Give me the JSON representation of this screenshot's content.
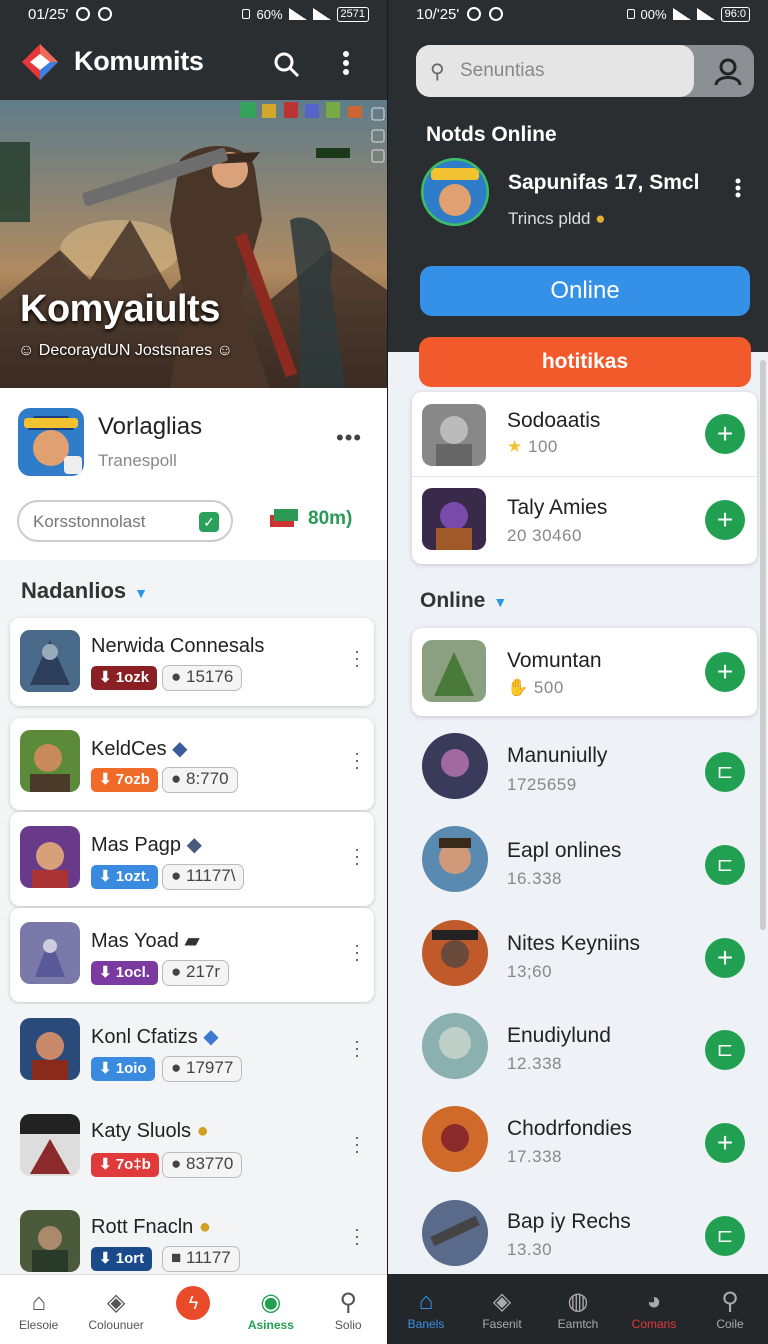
{
  "left": {
    "status": {
      "time": "01/25'",
      "battery_pct": "60%",
      "battery_box": "2571"
    },
    "app_title": "Komumits",
    "hero": {
      "title": "Komyaiults",
      "subtitle": "DecoraydUN Jostsnares"
    },
    "profile": {
      "name": "Vorlaglias",
      "sub": "Tranespoll",
      "pill_text": "Korsstonnolast",
      "gems": "80m)"
    },
    "section_title": "Nadanlios",
    "items": [
      {
        "title": "Nerwida Connesals",
        "badge": "1ozk",
        "score": "15176"
      },
      {
        "title": "KeldCes",
        "badge": "7ozb",
        "score": "8:770"
      },
      {
        "title": "Mas Pagp",
        "badge": "1ozt.",
        "score": "11177\\"
      },
      {
        "title": "Mas Yoad",
        "badge": "1ocl.",
        "score": "217r"
      },
      {
        "title": "Konl Cfatizs",
        "badge": "1oio",
        "score": "17977"
      },
      {
        "title": "Katy Sluols",
        "badge": "7o‡b",
        "score": "83770"
      },
      {
        "title": "Rott Fnacln",
        "badge": "1ort",
        "score": "11177"
      }
    ],
    "nav": [
      {
        "label": "Elesoie",
        "icon": "home-icon"
      },
      {
        "label": "Colounuer",
        "icon": "cube-icon"
      },
      {
        "label": "",
        "icon": "fire-icon"
      },
      {
        "label": "Asiness",
        "icon": "compass-icon"
      },
      {
        "label": "Solio",
        "icon": "search-icon"
      }
    ]
  },
  "right": {
    "status": {
      "time": "10/'25'",
      "battery_pct": "00%",
      "battery_box": "96:0"
    },
    "search_placeholder": "Senuntias",
    "section_online_title": "Notds Online",
    "featured": {
      "name": "Sapunifas 17, Smcl",
      "sub": "Trincs pldd"
    },
    "online_button": "Online",
    "hot_button": "hotitikas",
    "top_items": [
      {
        "name": "Sodoaatis",
        "value": "100"
      },
      {
        "name": "Taly Amies",
        "value": "20 30460"
      }
    ],
    "section_title": "Online",
    "list": [
      {
        "name": "Vomuntan",
        "value": "500",
        "action": "add"
      },
      {
        "name": "Manuniully",
        "value": "1725659",
        "action": "remove"
      },
      {
        "name": "Eapl onlines",
        "value": "16.338",
        "action": "remove"
      },
      {
        "name": "Nites Keyniins",
        "value": "13;60",
        "action": "add"
      },
      {
        "name": "Enudiylund",
        "value": "12.338",
        "action": "remove"
      },
      {
        "name": "Chodrfondies",
        "value": "17.338",
        "action": "add"
      },
      {
        "name": "Bap iy Rechs",
        "value": "13.30",
        "action": "remove"
      }
    ],
    "nav": [
      {
        "label": "Banels",
        "icon": "home-icon"
      },
      {
        "label": "Fasenit",
        "icon": "cube-icon"
      },
      {
        "label": "Eamtch",
        "icon": "globe-icon"
      },
      {
        "label": "Comans",
        "icon": "alien-icon"
      },
      {
        "label": "Coile",
        "icon": "search-icon"
      }
    ],
    "colors": {
      "accent": "#3591e8",
      "hot": "#f25a2c",
      "add": "#20a050"
    }
  }
}
